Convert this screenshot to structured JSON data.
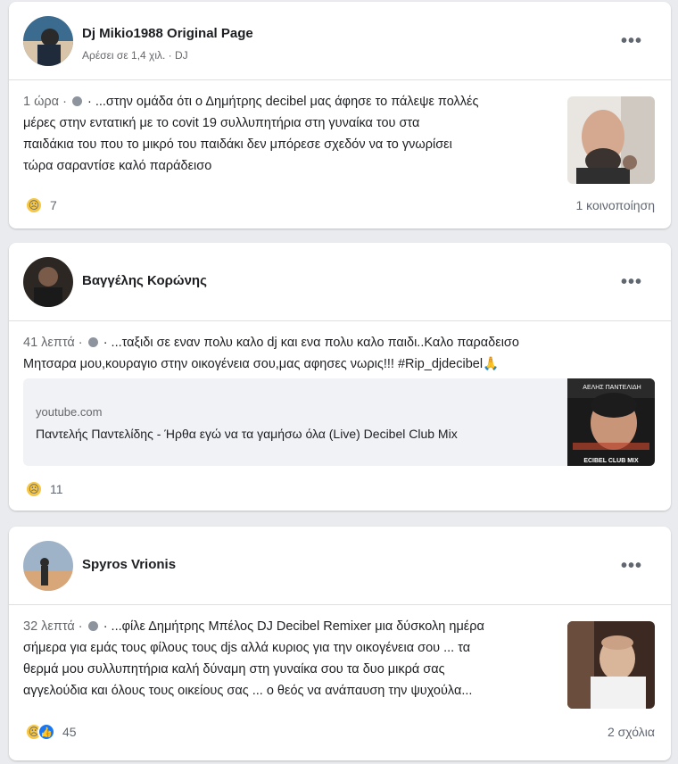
{
  "posts": [
    {
      "author": "Dj Mikio1988 Original Page",
      "meta": "Αρέσει σε 1,4 χιλ. · DJ",
      "more": "•••",
      "timestamp": "1 ώρα ·",
      "text_lines": [
        "· ...στην ομάδα ότι ο Δημήτρης decibel μας άφησε το πάλεψε πολλές",
        "μέρες στην εντατική με το covit 19 συλλυπητήρια στη γυναίκα του στα",
        "παιδάκια του που το μικρό του παιδάκι δεν μπόρεσε σχεδόν να το γνωρίσει",
        "τώρα σαραντίσε καλό παράδεισο"
      ],
      "reaction_count": "7",
      "shares": "1 κοινοποίηση",
      "avatar_icon": "profile-photo-icon",
      "thumb_icon": "man-portrait-icon"
    },
    {
      "author": "Βαγγέλης Κορώνης",
      "more": "•••",
      "timestamp": "41 λεπτά ·",
      "text_lines": [
        "· ...ταξιδι σε εναν πολυ καλο dj και ενα πολυ καλο παιδι..Καλο παραδεισο",
        "Μητσαρα μου,κουραγιο στην οικογένεια σου,μας αφησες νωρις!!! #Rip_djdecibel🙏"
      ],
      "link": {
        "domain": "youtube.com",
        "title": "Παντελής Παντελίδης - Ήρθα εγώ να τα γαμήσω όλα (Live) Decibel Club Mix",
        "thumb_top_text": "ΑΕΛΗΣ ΠΑΝΤΕΛΙΔΗ",
        "thumb_bottom_text": "ECIBEL CLUB MIX"
      },
      "reaction_count": "11",
      "avatar_icon": "profile-photo-icon"
    },
    {
      "author": "Spyros Vrionis",
      "more": "•••",
      "timestamp": "32 λεπτά ·",
      "text_lines": [
        "· ...φίλε Δημήτρης Μπέλος DJ Decibel Remixer μια δύσκολη ημέρα",
        "σήμερα για εμάς τους φίλους τους djs αλλά κυριος για την οικογένεια σου ... τα",
        "θερμά μου συλλυπητήρια καλή δύναμη στη γυναίκα σου τα δυο μικρά σας",
        "αγγελούδια και όλους τους οικείους σας ... ο θεός να ανάπαυση την ψυχούλα..."
      ],
      "reaction_count": "45",
      "comments": "2 σχόλια",
      "avatar_icon": "profile-photo-icon",
      "thumb_icon": "man-portrait-icon"
    }
  ],
  "colors": {
    "background": "#e9ebee",
    "card": "#ffffff",
    "secondary_text": "#65676b",
    "like_blue": "#1877f2",
    "sad_yellow": "#f7c643"
  }
}
